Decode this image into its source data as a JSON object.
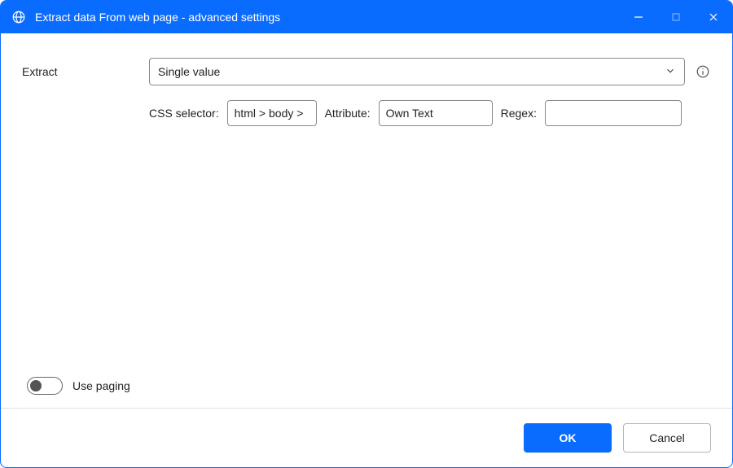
{
  "window": {
    "title": "Extract data From web page - advanced settings"
  },
  "form": {
    "extract_label": "Extract",
    "extract_value": "Single value",
    "css_label": "CSS selector:",
    "css_value": "html > body >",
    "attr_label": "Attribute:",
    "attr_value": "Own Text",
    "regex_label": "Regex:",
    "regex_value": ""
  },
  "paging": {
    "label": "Use paging",
    "on": false
  },
  "footer": {
    "ok": "OK",
    "cancel": "Cancel"
  }
}
